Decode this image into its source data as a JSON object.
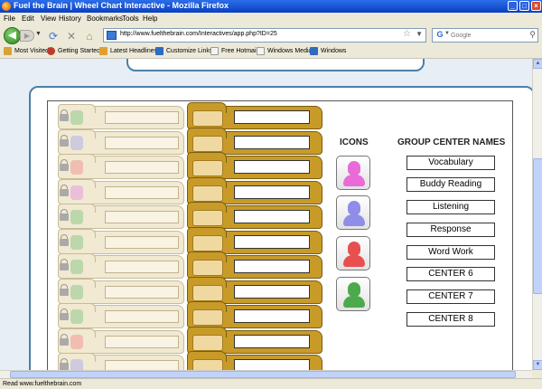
{
  "window": {
    "title": "Fuel the Brain | Wheel Chart Interactive - Mozilla Firefox"
  },
  "menu": [
    "File",
    "Edit",
    "View",
    "History",
    "Bookmarks",
    "Tools",
    "Help"
  ],
  "nav": {
    "url": "http://www.fuelthebrain.com/Interactives/app.php?ID=25",
    "search_placeholder": "Google"
  },
  "bookmarks": [
    {
      "label": "Most Visited",
      "icon": "most-visited-icon",
      "color": "#d6a23a"
    },
    {
      "label": "Getting Started",
      "icon": "firefox-icon",
      "color": "#c0392b"
    },
    {
      "label": "Latest Headlines",
      "icon": "rss-icon",
      "color": "#e0a030"
    },
    {
      "label": "Customize Links",
      "icon": "msn-icon",
      "color": "#2d6cc0"
    },
    {
      "label": "Free Hotmail",
      "icon": "page-icon",
      "color": "#e8e8e8"
    },
    {
      "label": "Windows Media",
      "icon": "page-icon",
      "color": "#e8e8e8"
    },
    {
      "label": "Windows",
      "icon": "msn-icon",
      "color": "#2d6cc0"
    }
  ],
  "chart": {
    "icons_title": "ICONS",
    "names_title": "GROUP CENTER NAMES",
    "group_names": [
      "Vocabulary",
      "Buddy Reading",
      "Listening",
      "Response",
      "Word Work",
      "CENTER 6",
      "CENTER 7",
      "CENTER 8"
    ],
    "icon_colors": [
      {
        "name": "pink-student-icon",
        "color": "#e86bd8"
      },
      {
        "name": "purple-student-icon",
        "color": "#8e8ee8"
      },
      {
        "name": "red-student-icon",
        "color": "#e85050"
      },
      {
        "name": "green-student-icon",
        "color": "#4caa4c"
      }
    ],
    "left_slot_colors": [
      "#7cc27c",
      "#a3a3f0",
      "#f08a8a",
      "#e48ae4",
      "#7cc27c",
      "#7cc27c",
      "#7cc27c",
      "#7cc27c",
      "#7cc27c",
      "#f08a8a",
      "#a3a3f0"
    ]
  },
  "status": "Read www.fuelthebrain.com"
}
